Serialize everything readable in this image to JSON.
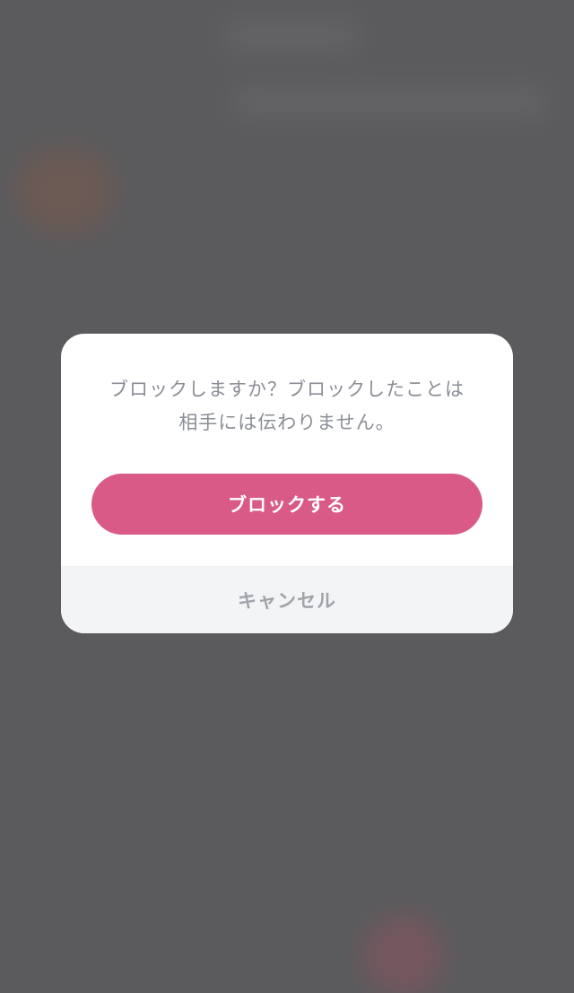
{
  "dialog": {
    "message_line1": "ブロックしますか？ブロックしたことは",
    "message_line2": "相手には伝わりません。",
    "confirm_label": "ブロックする",
    "cancel_label": "キャンセル"
  },
  "colors": {
    "overlay": "#5b5b5d",
    "accent": "#d95a87",
    "footer_bg": "#f3f4f6",
    "message_text": "#8a8e96"
  }
}
